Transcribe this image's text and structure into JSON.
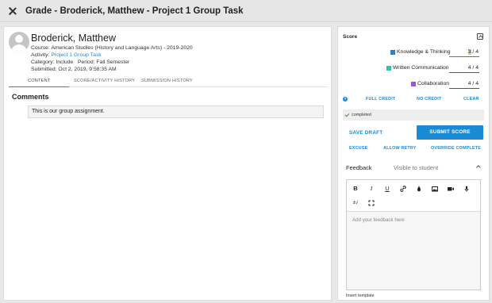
{
  "window": {
    "title": "Grade - Broderick, Matthew - Project 1 Group Task"
  },
  "student": {
    "name": "Broderick, Matthew",
    "course_label": "Course:",
    "course": "American Studies (History and Language Arts) - 2019-2020",
    "activity_label": "Activity:",
    "activity": "Project 1 Group Task",
    "category_label": "Category:",
    "category": "Include",
    "period_label": "Period:",
    "period": "Fall Semester",
    "submitted_label": "Submitted:",
    "submitted": "Oct 2, 2019, 9:58:35 AM"
  },
  "tabs": [
    {
      "label": "CONTENT",
      "active": true
    },
    {
      "label": "SCORE/ACTIVITY HISTORY",
      "active": false
    },
    {
      "label": "SUBMISSION HISTORY",
      "active": false
    }
  ],
  "comments": {
    "heading": "Comments",
    "items": [
      "This is our group assignment."
    ]
  },
  "score_panel": {
    "heading": "Score",
    "criteria": [
      {
        "label": "Knowledge & Thinking",
        "score": "3",
        "max": "4",
        "color": "#2f7fc1",
        "focused": true
      },
      {
        "label": "Written Communication",
        "score": "4",
        "max": "4",
        "color": "#2ec4a6",
        "focused": false
      },
      {
        "label": "Collaboration",
        "score": "4",
        "max": "4",
        "color": "#9b59c6",
        "focused": false
      }
    ],
    "full_credit": "FULL CREDIT",
    "no_credit": "NO CREDIT",
    "clear": "CLEAR",
    "status": "completed",
    "save_draft": "SAVE DRAFT",
    "submit_score": "SUBMIT SCORE",
    "excuse": "EXCUSE",
    "allow_retry": "ALLOW RETRY",
    "override_complete": "OVERRIDE COMPLETE"
  },
  "feedback": {
    "heading": "Feedback",
    "visibility": "Visible to student",
    "placeholder": "Add your feedback here",
    "insert_template": "Insert template",
    "toolbar": {
      "bold": "B",
      "italic": "I",
      "underline": "U",
      "math": "±√",
      "icons": [
        "link-icon",
        "ink-drop-icon",
        "image-icon",
        "video-icon",
        "microphone-icon",
        "fullscreen-icon"
      ]
    }
  },
  "colors": {
    "accent": "#1a8ad4",
    "highlight": "#b9e3a4"
  }
}
